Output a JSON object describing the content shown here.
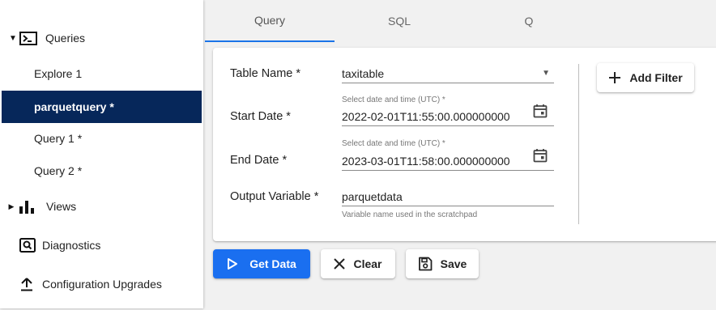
{
  "sidebar": {
    "queries_label": "Queries",
    "items": [
      {
        "label": "Explore 1"
      },
      {
        "label": "parquetquery *"
      },
      {
        "label": "Query 1 *"
      },
      {
        "label": "Query 2 *"
      }
    ],
    "views_label": "Views",
    "diagnostics_label": "Diagnostics",
    "config_upgrades_label": "Configuration Upgrades"
  },
  "tabs": [
    {
      "label": "Query"
    },
    {
      "label": "SQL"
    },
    {
      "label": "Q"
    }
  ],
  "form": {
    "table_name": {
      "label": "Table Name *",
      "value": "taxitable"
    },
    "start_date": {
      "label": "Start Date *",
      "hint": "Select date and time (UTC) *",
      "value": "2022-02-01T11:55:00.000000000"
    },
    "end_date": {
      "label": "End Date *",
      "hint": "Select date and time (UTC) *",
      "value": "2023-03-01T11:58:00.000000000"
    },
    "output_variable": {
      "label": "Output Variable *",
      "value": "parquetdata",
      "helper": "Variable name used in the scratchpad"
    },
    "add_filter_label": "Add Filter"
  },
  "actions": {
    "get_data_label": "Get Data",
    "clear_label": "Clear",
    "save_label": "Save"
  },
  "colors": {
    "active_nav_bg": "#06275a",
    "primary_button": "#1a6ff0",
    "tab_indicator": "#1a73e8"
  }
}
